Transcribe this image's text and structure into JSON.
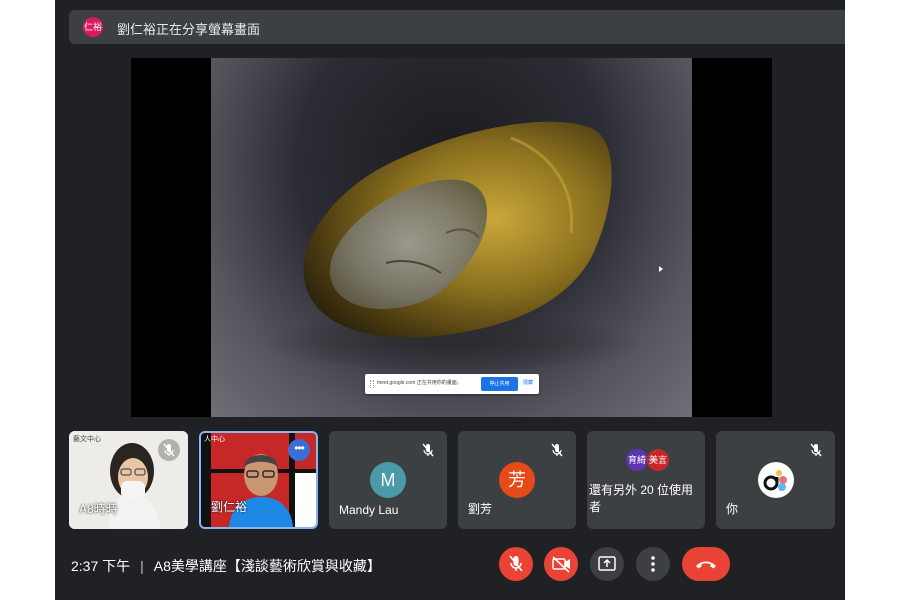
{
  "banner": {
    "avatar": "仁裕",
    "text": "劉仁裕正在分享螢幕畫面"
  },
  "share_bar": {
    "message": "meet.google.com 正在共用你的畫面。",
    "stop_label": "停止共用",
    "hide_label": "隱藏"
  },
  "tiles": [
    {
      "name": "A8時時",
      "logo": "藝文中心",
      "muted": true
    },
    {
      "name": "劉仁裕",
      "logo": "人中心",
      "muted": false
    },
    {
      "name": "Mandy Lau",
      "initial": "M",
      "color": "#4a9aa8",
      "muted": true
    },
    {
      "name": "劉芳",
      "initial": "芳",
      "color": "#e64a19",
      "muted": true
    },
    {
      "label": "還有另外 20 位使用者",
      "avatars": [
        {
          "text": "育綺",
          "color": "#5e35b1"
        },
        {
          "text": "美言",
          "color": "#c62828"
        }
      ]
    },
    {
      "name": "你",
      "muted": true
    }
  ],
  "meeting": {
    "time": "2:37 下午",
    "separator": "|",
    "title": "A8美學講座【淺談藝術欣賞與收藏】"
  },
  "colors": {
    "background": "#202124",
    "tile": "#3c4043",
    "danger": "#ea4335",
    "control": "#3c4043",
    "highlight": "#8ab4f8"
  }
}
